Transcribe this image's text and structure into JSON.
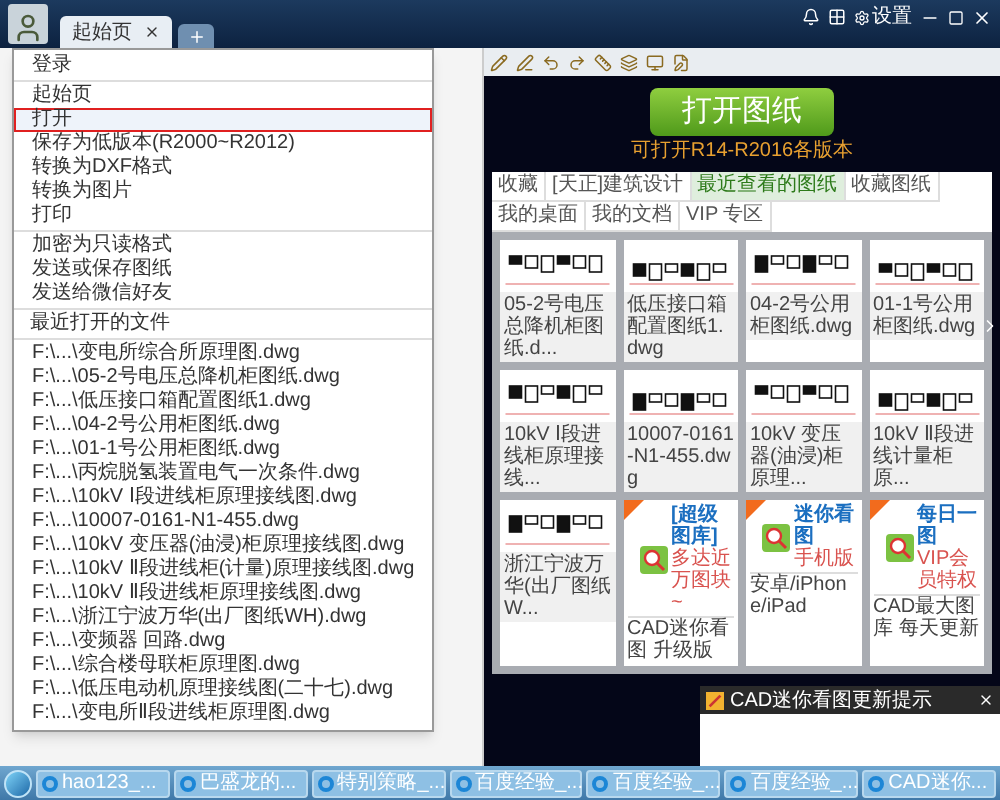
{
  "window": {
    "tabs": [
      {
        "label": "起始页",
        "selected": true
      }
    ],
    "settings": "设置"
  },
  "menu": {
    "groups": [
      [
        {
          "kind": "command",
          "label": "登录",
          "selected": false
        }
      ],
      [
        {
          "kind": "command",
          "label": "起始页",
          "selected": false
        },
        {
          "kind": "command",
          "label": "打开",
          "selected": true
        },
        {
          "kind": "command",
          "label": "保存为低版本(R2000~R2012)",
          "selected": false
        },
        {
          "kind": "command",
          "label": "转换为DXF格式",
          "selected": false
        },
        {
          "kind": "command",
          "label": "转换为图片",
          "selected": false
        },
        {
          "kind": "command",
          "label": "打印",
          "selected": false
        }
      ],
      [
        {
          "kind": "command",
          "label": "加密为只读格式",
          "selected": false
        },
        {
          "kind": "command",
          "label": "发送或保存图纸",
          "selected": false
        },
        {
          "kind": "command",
          "label": "发送给微信好友",
          "selected": false
        }
      ],
      [
        {
          "kind": "heading",
          "label": "最近打开的文件"
        }
      ],
      [
        {
          "kind": "command",
          "label": "F:\\...\\变电所综合所原理图.dwg",
          "selected": false
        },
        {
          "kind": "command",
          "label": "F:\\...\\05-2号电压总降机柜图纸.dwg",
          "selected": false
        },
        {
          "kind": "command",
          "label": "F:\\...\\低压接口箱配置图纸1.dwg",
          "selected": false
        },
        {
          "kind": "command",
          "label": "F:\\...\\04-2号公用柜图纸.dwg",
          "selected": false
        },
        {
          "kind": "command",
          "label": "F:\\...\\01-1号公用柜图纸.dwg",
          "selected": false
        },
        {
          "kind": "command",
          "label": "F:\\...\\丙烷脱氢装置电气一次条件.dwg",
          "selected": false
        },
        {
          "kind": "command",
          "label": "F:\\...\\10kV Ⅰ段进线柜原理接线图.dwg",
          "selected": false
        },
        {
          "kind": "command",
          "label": "F:\\...\\10007-0161-N1-455.dwg",
          "selected": false
        },
        {
          "kind": "command",
          "label": "F:\\...\\10kV 变压器(油浸)柜原理接线图.dwg",
          "selected": false
        },
        {
          "kind": "command",
          "label": "F:\\...\\10kV Ⅱ段进线柜(计量)原理接线图.dwg",
          "selected": false
        },
        {
          "kind": "command",
          "label": "F:\\...\\10kV Ⅱ段进线柜原理接线图.dwg",
          "selected": false
        },
        {
          "kind": "command",
          "label": "F:\\...\\浙江宁波万华(出厂图纸WH).dwg",
          "selected": false
        },
        {
          "kind": "command",
          "label": "F:\\...\\变频器 回路.dwg",
          "selected": false
        },
        {
          "kind": "command",
          "label": "F:\\...\\综合楼母联柜原理图.dwg",
          "selected": false
        },
        {
          "kind": "command",
          "label": "F:\\...\\低压电动机原理接线图(二十七).dwg",
          "selected": false
        },
        {
          "kind": "command",
          "label": "F:\\...\\变电所Ⅱ段进线柜原理图.dwg",
          "selected": false
        }
      ]
    ]
  },
  "start": {
    "open_button": "打开图纸",
    "subtitle": "可打开R14-R2016各版本"
  },
  "tabs": [
    {
      "label": "收藏",
      "selected": false
    },
    {
      "label": "[天正]建筑设计",
      "selected": false
    },
    {
      "label": "最近查看的图纸",
      "selected": true
    },
    {
      "label": "收藏图纸",
      "selected": false
    },
    {
      "label": "我的桌面",
      "selected": false
    },
    {
      "label": "我的文档",
      "selected": false
    },
    {
      "label": "VIP 专区",
      "selected": false
    }
  ],
  "cards": [
    {
      "kind": "drawing",
      "label": "05-2号电压总降机柜图纸.d..."
    },
    {
      "kind": "drawing",
      "label": "低压接口箱配置图纸1.dwg"
    },
    {
      "kind": "drawing",
      "label": "04-2号公用柜图纸.dwg"
    },
    {
      "kind": "drawing",
      "label": "01-1号公用柜图纸.dwg"
    },
    {
      "kind": "drawing",
      "label": "10kV Ⅰ段进线柜原理接线..."
    },
    {
      "kind": "drawing",
      "label": "10007-0161-N1-455.dwg"
    },
    {
      "kind": "drawing",
      "label": "10kV 变压器(油浸)柜原理..."
    },
    {
      "kind": "drawing",
      "label": "10kV Ⅱ段进线计量柜原..."
    },
    {
      "kind": "drawing",
      "label": "浙江宁波万华(出厂图纸W..."
    },
    {
      "kind": "promo",
      "lines": [
        "[超级图库]",
        "多达近万图块~"
      ],
      "label": "CAD迷你看图 升级版"
    },
    {
      "kind": "promo",
      "lines": [
        "迷你看图",
        "手机版"
      ],
      "label": "安卓/iPhone/iPad"
    },
    {
      "kind": "promo",
      "lines": [
        "每日一图",
        "VIP会员特权"
      ],
      "label": "CAD最大图库 每天更新"
    }
  ],
  "notification": {
    "title": "CAD迷你看图更新提示"
  },
  "taskbar": [
    {
      "label": "hao123_..."
    },
    {
      "label": "巴盛龙的..."
    },
    {
      "label": "特别策略_..."
    },
    {
      "label": "百度经验_..."
    },
    {
      "label": "百度经验_..."
    },
    {
      "label": "百度经验_..."
    },
    {
      "label": "CAD迷你..."
    }
  ]
}
